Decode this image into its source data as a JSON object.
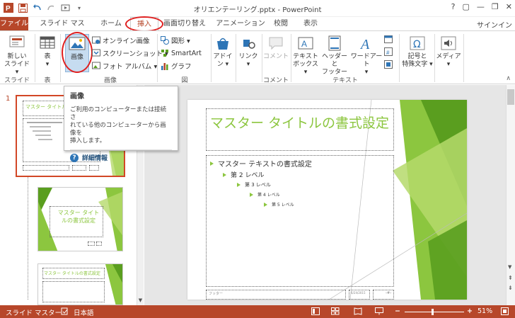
{
  "app": {
    "title": "オリエンテーリング.pptx - PowerPoint",
    "window_controls": [
      "?",
      "▢",
      "—",
      "❐",
      "✕"
    ],
    "sign_in": "サインイン"
  },
  "tabs": [
    {
      "label": "ファイル"
    },
    {
      "label": "スライド マスター"
    },
    {
      "label": "ホーム"
    },
    {
      "label": "挿入"
    },
    {
      "label": "画面切り替え"
    },
    {
      "label": "アニメーション"
    },
    {
      "label": "校閲"
    },
    {
      "label": "表示"
    }
  ],
  "ribbon": {
    "new_slide": "新しい\nスライド",
    "new_slide_l1": "新しい",
    "new_slide_l2": "スライド ▾",
    "table": "表",
    "table_arrow": "▾",
    "image": "画像",
    "online_image": "オンライン画像",
    "screenshot": "スクリーンショット ▾",
    "photo_album": "フォト アルバム ▾",
    "shapes": "図形 ▾",
    "smartart": "SmartArt",
    "graph": "グラフ",
    "addin_l1": "アドイ",
    "addin_l2": "ン ▾",
    "link_l1": "リンク",
    "link_l2": "▾",
    "comment": "コメント",
    "textbox_l1": "テキスト",
    "textbox_l2": "ボックス ▾",
    "header_l1": "ヘッダーと",
    "header_l2": "フッター",
    "wordart_l1": "ワードアート",
    "wordart_l2": "▾",
    "symbol_l1": "記号と",
    "symbol_l2": "特殊文字 ▾",
    "media_l1": "メディア",
    "media_l2": "▾",
    "groups": {
      "slide": "スライド",
      "table": "表",
      "image": "画像",
      "figure": "図",
      "comment": "コメント",
      "text": "テキスト"
    }
  },
  "tooltip": {
    "title": "画像",
    "body_l1": "ご利用のコンピューターまたは接続さ",
    "body_l2": "れている他のコンピューターから画像を",
    "body_l3": "挿入します。",
    "link": "詳細情報"
  },
  "thumbnails": {
    "index": "1",
    "slide1_title": "マスター タイトルの",
    "slide2_title_l1": "マスター タイト",
    "slide2_title_l2": "ルの書式設定",
    "slide3_title": "マスター タイトルの書式設定"
  },
  "slide": {
    "title": "マスター タイトルの書式設定",
    "bullets": [
      {
        "level": 1,
        "text": "マスター テキストの書式設定"
      },
      {
        "level": 2,
        "text": "第 2 レベル"
      },
      {
        "level": 3,
        "text": "第 3 レベル"
      },
      {
        "level": 4,
        "text": "第 4 レベル"
      },
      {
        "level": 5,
        "text": "第 5 レベル"
      }
    ],
    "footer": "フッター",
    "date": "6/24/2015",
    "page": "‹#›"
  },
  "statusbar": {
    "mode": "スライド マスター",
    "language": "日本語",
    "zoom": "51%"
  },
  "colors": {
    "accent": "#b7472a",
    "green": "#8cc63f",
    "dark_green": "#5a9e1f",
    "annotation": "#e02020"
  }
}
